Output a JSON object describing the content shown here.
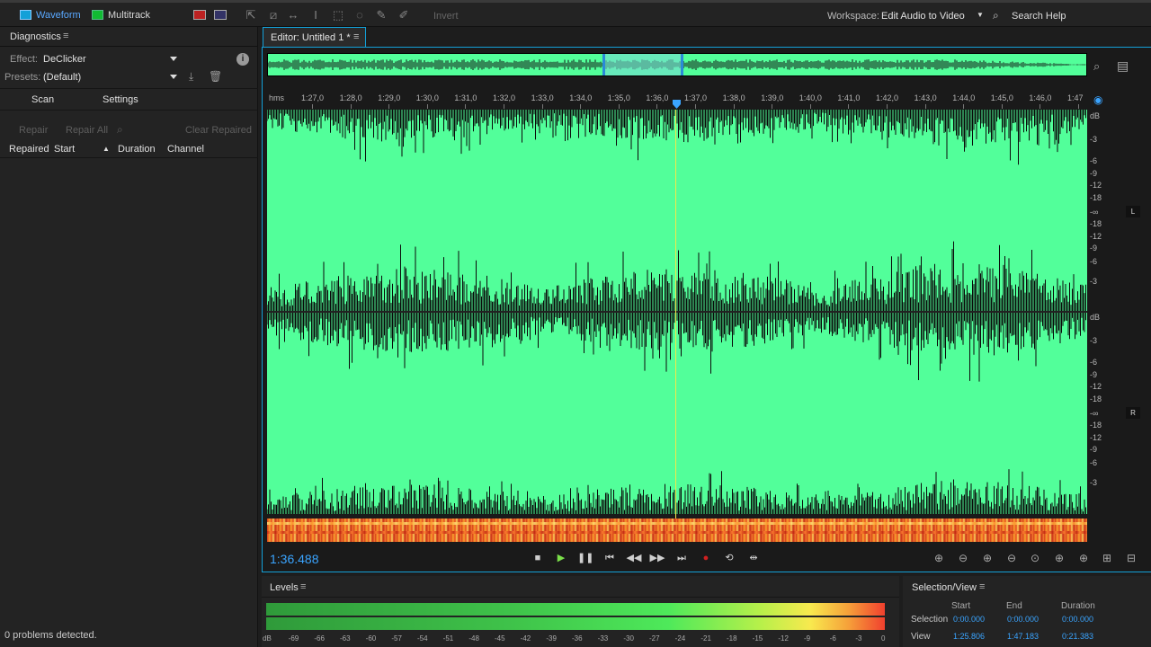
{
  "toolbar": {
    "waveform_label": "Waveform",
    "multitrack_label": "Multitrack",
    "invert_label": "Invert",
    "workspace_label": "Workspace:",
    "workspace_value": "Edit Audio to Video",
    "search_label": "Search Help"
  },
  "diagnostics": {
    "title": "Diagnostics",
    "effect_label": "Effect:",
    "effect_value": "DeClicker",
    "presets_label": "Presets:",
    "presets_value": "(Default)",
    "tabs": [
      "Scan",
      "Settings"
    ],
    "repair_label": "Repair",
    "repair_all_label": "Repair All",
    "clear_repaired_label": "Clear Repaired",
    "columns": [
      "Repaired",
      "Start",
      "Duration",
      "Channel"
    ],
    "status": "0 problems detected."
  },
  "editor": {
    "tab_label": "Editor: Untitled 1 *",
    "ruler_unit": "hms",
    "ruler_ticks": [
      "1:27,0",
      "1:28,0",
      "1:29,0",
      "1:30,0",
      "1:31,0",
      "1:32,0",
      "1:33,0",
      "1:34,0",
      "1:35,0",
      "1:36,0",
      "1:37,0",
      "1:38,0",
      "1:39,0",
      "1:40,0",
      "1:41,0",
      "1:42,0",
      "1:43,0",
      "1:44,0",
      "1:45,0",
      "1:46,0",
      "1:47"
    ],
    "db_scale": [
      "dB",
      "-3",
      "-6",
      "-9",
      "-12",
      "-18",
      "-∞",
      "-18",
      "-12",
      "-9",
      "-6",
      "-3"
    ],
    "left_channel": "L",
    "right_channel": "R",
    "current_time": "1:36.488"
  },
  "levels": {
    "title": "Levels",
    "scale": [
      "dB",
      "-69",
      "-66",
      "-63",
      "-60",
      "-57",
      "-54",
      "-51",
      "-48",
      "-45",
      "-42",
      "-39",
      "-36",
      "-33",
      "-30",
      "-27",
      "-24",
      "-21",
      "-18",
      "-15",
      "-12",
      "-9",
      "-6",
      "-3",
      "0"
    ]
  },
  "selection_view": {
    "title": "Selection/View",
    "headers": [
      "Start",
      "End",
      "Duration"
    ],
    "rows": [
      {
        "label": "Selection",
        "start": "0:00.000",
        "end": "0:00.000",
        "duration": "0:00.000"
      },
      {
        "label": "View",
        "start": "1:25.806",
        "end": "1:47.183",
        "duration": "0:21.383"
      }
    ]
  },
  "colors": {
    "accent": "#13a0d8",
    "waveform_bg": "#52ff9a",
    "timecode": "#3aa4ff",
    "playhead": "#f1e84a"
  }
}
